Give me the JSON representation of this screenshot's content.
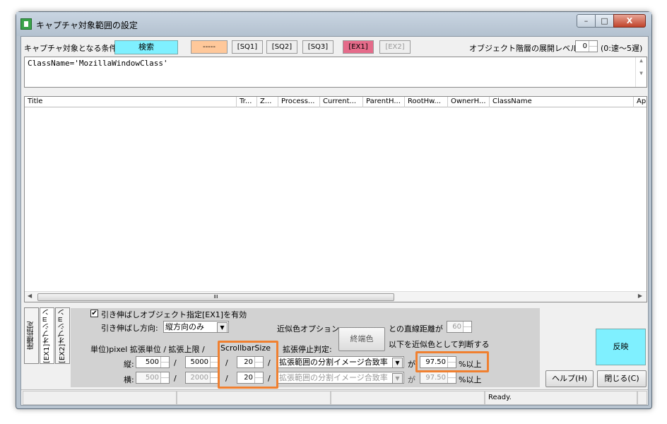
{
  "window": {
    "title": "キャプチャ対象範囲の設定",
    "min": "–",
    "max": "□",
    "close": "X"
  },
  "toolbar": {
    "condition_label": "キャプチャ対象となる条件:",
    "search_button": "検索",
    "dash_button": "-----",
    "sq1": "[SQ1]",
    "sq2": "[SQ2]",
    "sq3": "[SQ3]",
    "ex1": "[EX1]",
    "ex2": "[EX2]",
    "level_label": "オブジェクト階層の展開レベル:",
    "level_value": "0",
    "level_note": "(0:速〜5遅)"
  },
  "query": {
    "text": "ClassName='MozillaWindowClass'"
  },
  "table": {
    "columns": [
      "Title",
      "Tr...",
      "Z...",
      "Process...",
      "Current...",
      "ParentH...",
      "RootHw...",
      "OwnerH...",
      "ClassName",
      "Ap"
    ],
    "rows": [],
    "scroll_thumb": "III"
  },
  "tabs": [
    "座標指定",
    "[EX1]オプション",
    "[EX2]オプション"
  ],
  "options": {
    "stretch_enable_checked": true,
    "stretch_enable_label": "引き伸ばしオブジェクト指定[EX1]を有効",
    "direction_label": "引き伸ばし方向:",
    "direction_value": "縦方向のみ",
    "unit_header": "単位)pixel  拡張単位 / 拡張上限 /",
    "scrollbar_size_label": "ScrollbarSize",
    "stop_label": "拡張停止判定:",
    "vert_label": "縦:",
    "horiz_label": "横:",
    "vert": {
      "unit": "500",
      "limit": "5000",
      "scrollbar": "20",
      "method": "拡張範囲の分割イメージ合致率",
      "ga": "が",
      "threshold": "97.50",
      "suffix": "%以上"
    },
    "horiz": {
      "unit": "500",
      "limit": "2000",
      "scrollbar": "20",
      "method": "拡張範囲の分割イメージ合致率",
      "ga": "が",
      "threshold": "97.50",
      "suffix": "%以上"
    },
    "slash": "/",
    "approx_label": "近似色オプション:",
    "endpoint_color_button": "終端色",
    "distance_label": "との直線距離が",
    "distance_value": "60",
    "distance_note": "以下を近似色として判断する"
  },
  "buttons": {
    "reflect": "反映",
    "help": "ヘルプ(H)",
    "close": "閉じる(C)"
  },
  "status": {
    "panels": [
      "",
      "",
      "",
      "Ready.",
      ""
    ]
  }
}
